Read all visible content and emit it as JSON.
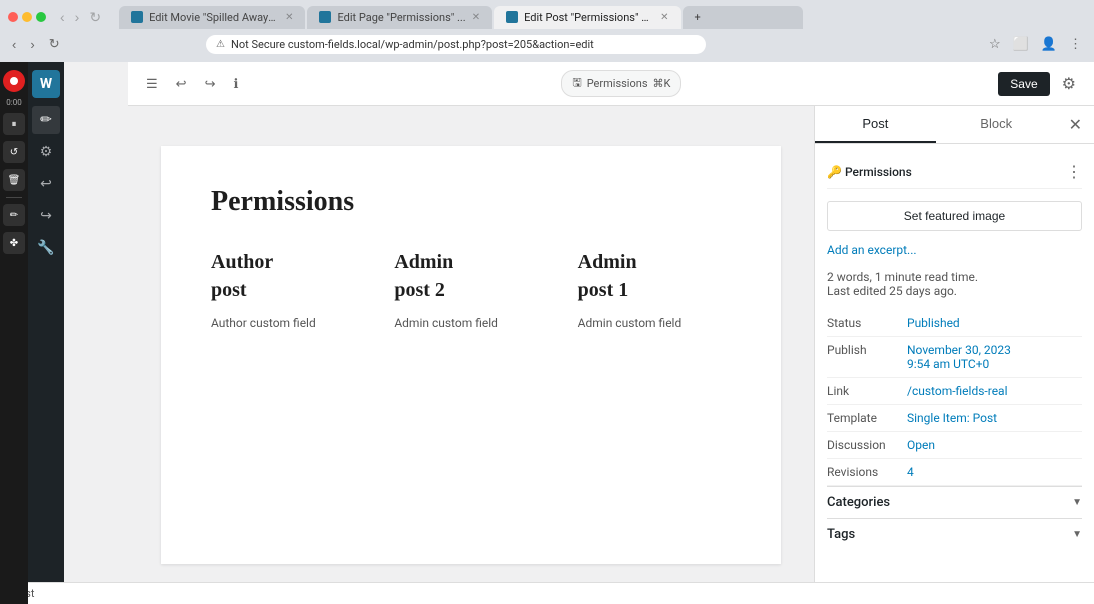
{
  "browser": {
    "tabs": [
      {
        "id": "tab1",
        "label": "Edit Movie \"Spilled Away\"...",
        "favicon": "wp",
        "active": false,
        "closeable": true
      },
      {
        "id": "tab2",
        "label": "Edit Page \"Permissions\" ...",
        "favicon": "wp",
        "active": false,
        "closeable": true
      },
      {
        "id": "tab3",
        "label": "Edit Post \"Permissions\" < ...",
        "favicon": "wp",
        "active": true,
        "closeable": true
      },
      {
        "id": "tab4",
        "label": "",
        "favicon": "",
        "active": false,
        "closeable": false
      }
    ],
    "address": "Not Secure  custom-fields.local/wp-admin/post.php?post=205&action=edit",
    "security_label": "Not Secure"
  },
  "editor": {
    "topbar": {
      "saved_badge": "Permissions",
      "saved_icon": "🖫",
      "saved_shortcut": "⌘K",
      "save_label": "Save",
      "settings_label": "Settings"
    },
    "post": {
      "title": "Permissions",
      "columns": [
        {
          "heading_line1": "Author",
          "heading_line2": "post",
          "field_label": "Author custom field"
        },
        {
          "heading_line1": "Admin",
          "heading_line2": "post 2",
          "field_label": "Admin custom field"
        },
        {
          "heading_line1": "Admin",
          "heading_line2": "post 1",
          "field_label": "Admin custom field"
        }
      ]
    }
  },
  "sidebar": {
    "tabs": [
      {
        "id": "post",
        "label": "Post",
        "active": true
      },
      {
        "id": "block",
        "label": "Block",
        "active": false
      }
    ],
    "plugin": {
      "name": "Permissions",
      "icon": "🔑"
    },
    "featured_image_btn": "Set featured image",
    "excerpt_link": "Add an excerpt...",
    "meta_info": "2 words, 1 minute read time.\nLast edited 25 days ago.",
    "meta_rows": [
      {
        "label": "Status",
        "value": "Published",
        "is_link": true
      },
      {
        "label": "Publish",
        "value": "November 30, 2023\n9:54 am UTC+0",
        "is_link": true
      },
      {
        "label": "Link",
        "value": "/custom-fields-real",
        "is_link": true
      },
      {
        "label": "Template",
        "value": "Single Item: Post",
        "is_link": true
      },
      {
        "label": "Discussion",
        "value": "Open",
        "is_link": true
      },
      {
        "label": "Revisions",
        "value": "4",
        "is_link": true
      }
    ],
    "categories_label": "Categories",
    "tags_label": "Tags"
  },
  "status_bar": {
    "label": "Post"
  },
  "recording": {
    "timer": "0:00"
  }
}
